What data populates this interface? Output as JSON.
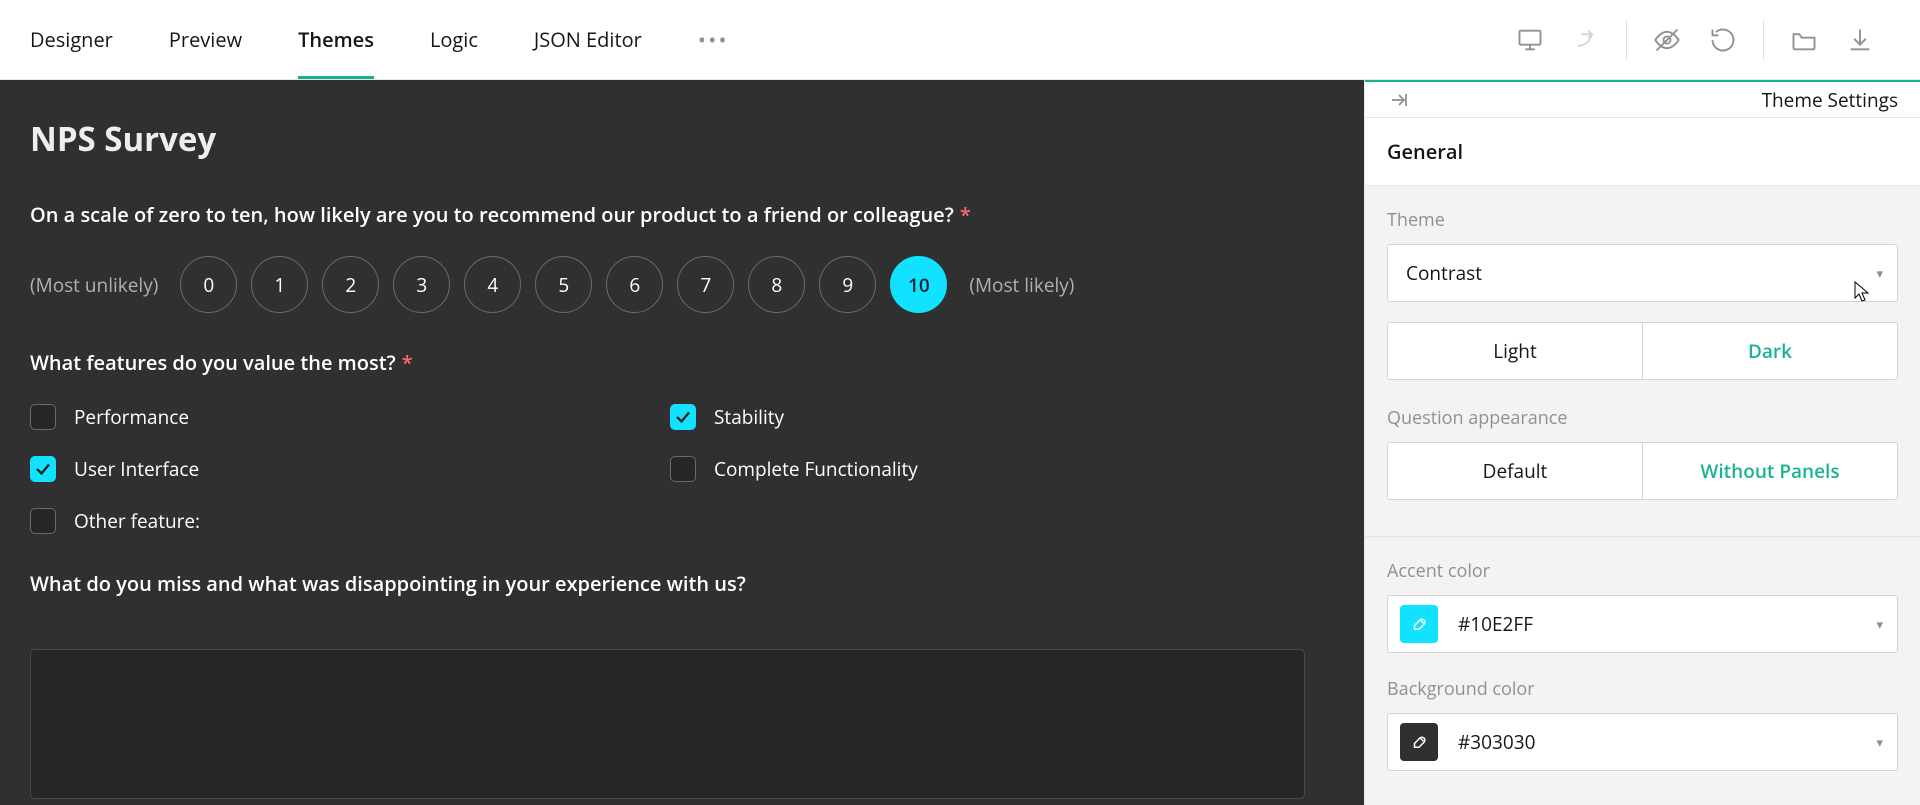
{
  "tabs": {
    "designer": "Designer",
    "preview": "Preview",
    "themes": "Themes",
    "logic": "Logic",
    "json": "JSON Editor"
  },
  "panel": {
    "title": "Theme Settings",
    "section_general": "General",
    "theme_label": "Theme",
    "theme_value": "Contrast",
    "mode_light": "Light",
    "mode_dark": "Dark",
    "qa_label": "Question appearance",
    "qa_default": "Default",
    "qa_nopanel": "Without Panels",
    "accent_label": "Accent color",
    "accent_hex": "#10E2FF",
    "bg_label": "Background color",
    "bg_hex": "#303030"
  },
  "survey": {
    "title": "NPS Survey",
    "q1_title": "On a scale of zero to ten, how likely are you to recommend our product to a friend or colleague?",
    "min_label": "(Most unlikely)",
    "max_label": "(Most likely)",
    "rates": [
      "0",
      "1",
      "2",
      "3",
      "4",
      "5",
      "6",
      "7",
      "8",
      "9",
      "10"
    ],
    "selected_rate": "10",
    "q2_title": "What features do you value the most?",
    "checks": [
      {
        "label": "Performance",
        "checked": false
      },
      {
        "label": "Stability",
        "checked": true
      },
      {
        "label": "User Interface",
        "checked": true
      },
      {
        "label": "Complete Functionality",
        "checked": false
      },
      {
        "label": "Other feature:",
        "checked": false
      }
    ],
    "q3_title": "What do you miss and what was disappointing in your experience with us?"
  }
}
